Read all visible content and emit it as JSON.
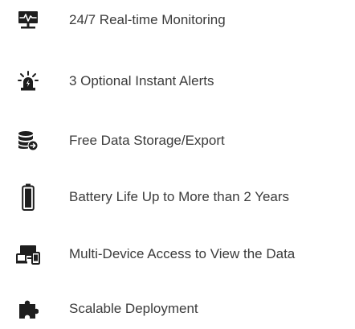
{
  "colors": {
    "icon": "#1e1e1e",
    "text": "#3b3b3b",
    "background": "#ffffff"
  },
  "features": [
    {
      "icon": "monitor-heartbeat-icon",
      "label": "24/7 Real-time Monitoring"
    },
    {
      "icon": "alarm-siren-icon",
      "label": "3 Optional Instant Alerts"
    },
    {
      "icon": "database-export-icon",
      "label": "Free Data Storage/Export"
    },
    {
      "icon": "battery-icon",
      "label": "Battery Life Up to More than 2 Years"
    },
    {
      "icon": "multi-device-icon",
      "label": "Multi-Device Access to View the Data"
    },
    {
      "icon": "puzzle-piece-icon",
      "label": "Scalable Deployment"
    }
  ]
}
